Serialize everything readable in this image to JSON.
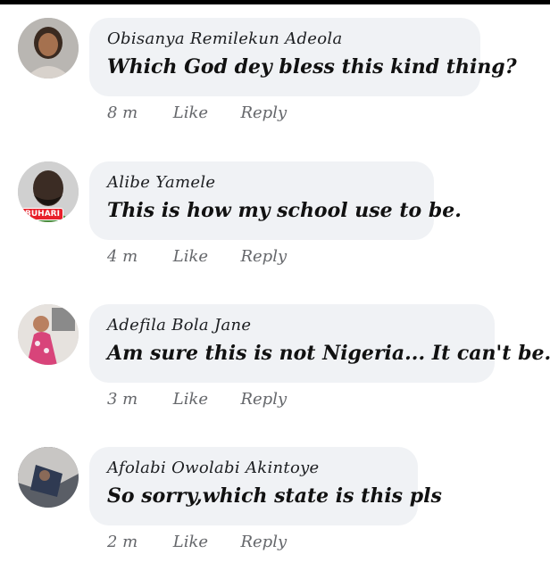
{
  "comments": [
    {
      "name": "Obisanya Remilekun Adeola",
      "text": "Which God dey bless this kind thing?",
      "time": "8 m",
      "like": "Like",
      "reply": "Reply"
    },
    {
      "name": "Alibe Yamele",
      "text": "This is how my school use to be.",
      "time": "4 m",
      "like": "Like",
      "reply": "Reply",
      "badge": "BUHARI"
    },
    {
      "name": "Adefila Bola Jane",
      "text": "Am sure this is not Nigeria... It can't be.",
      "time": "3 m",
      "like": "Like",
      "reply": "Reply"
    },
    {
      "name": "Afolabi Owolabi Akintoye",
      "text": "So sorry,which state is this pls",
      "time": "2 m",
      "like": "Like",
      "reply": "Reply"
    }
  ]
}
